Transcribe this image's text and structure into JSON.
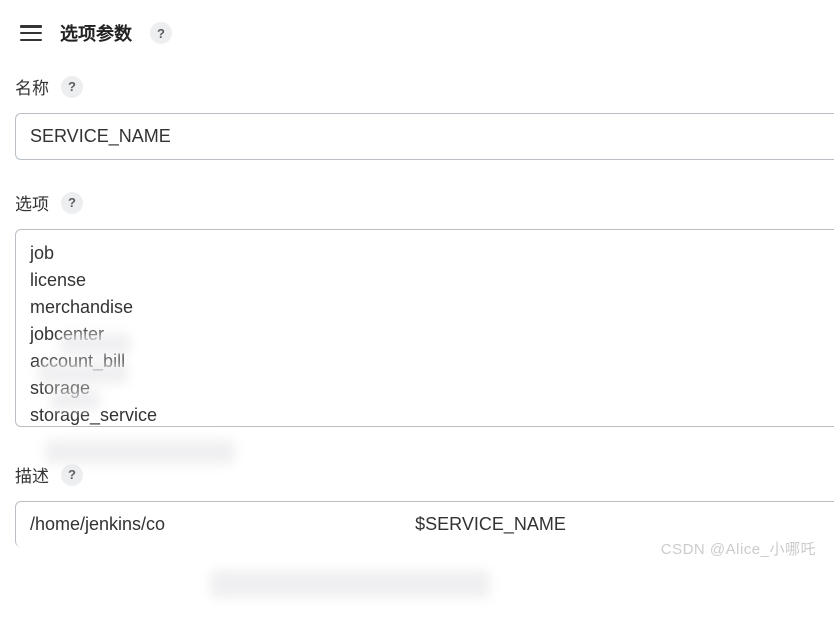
{
  "header": {
    "title": "选项参数"
  },
  "fields": {
    "name": {
      "label": "名称",
      "value": "SERVICE_NAME"
    },
    "options": {
      "label": "选项",
      "value": "job\nlicense\nmerchandise\njobcenter\naccount_bill\nstorage\nstorage_service"
    },
    "description": {
      "label": "描述",
      "value": "/home/jenkins/co                                                  $SERVICE_NAME"
    }
  },
  "watermark": "CSDN @Alice_小哪吒"
}
